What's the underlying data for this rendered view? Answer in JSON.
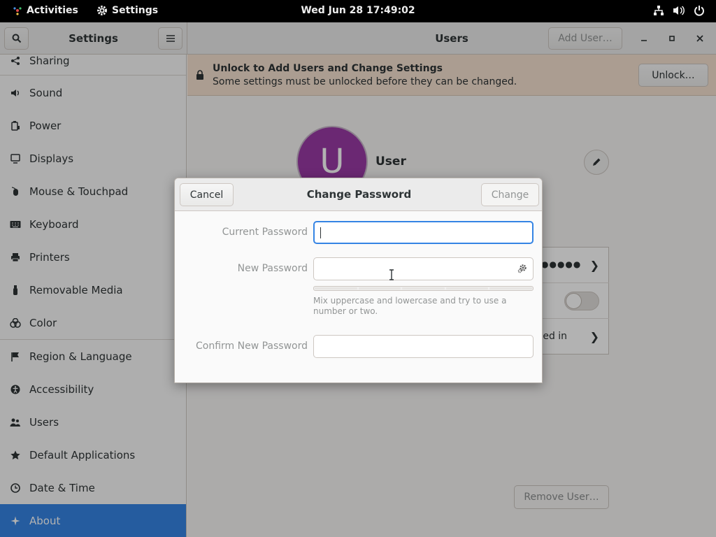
{
  "topbar": {
    "activities": "Activities",
    "app_menu": "Settings",
    "clock": "Wed Jun 28  17:49:02",
    "status_icons": [
      "network-icon",
      "volume-icon",
      "power-icon"
    ]
  },
  "headerbar": {
    "left_title": "Settings",
    "main_title": "Users",
    "add_user_label": "Add User…"
  },
  "sidebar": {
    "items": [
      {
        "label": "Sharing",
        "icon": "share-icon"
      },
      {
        "label": "Sound",
        "icon": "speaker-icon"
      },
      {
        "label": "Power",
        "icon": "battery-icon"
      },
      {
        "label": "Displays",
        "icon": "display-icon"
      },
      {
        "label": "Mouse & Touchpad",
        "icon": "mouse-icon"
      },
      {
        "label": "Keyboard",
        "icon": "keyboard-icon"
      },
      {
        "label": "Printers",
        "icon": "printer-icon"
      },
      {
        "label": "Removable Media",
        "icon": "usb-icon"
      },
      {
        "label": "Color",
        "icon": "palette-icon"
      },
      {
        "label": "Region & Language",
        "icon": "flag-icon"
      },
      {
        "label": "Accessibility",
        "icon": "accessibility-icon"
      },
      {
        "label": "Users",
        "icon": "users-icon"
      },
      {
        "label": "Default Applications",
        "icon": "star-icon"
      },
      {
        "label": "Date & Time",
        "icon": "clock-icon"
      },
      {
        "label": "About",
        "icon": "sparkle-icon",
        "active": true
      }
    ]
  },
  "infobar": {
    "title": "Unlock to Add Users and Change Settings",
    "subtitle": "Some settings must be unlocked before they can be changed.",
    "unlock_label": "Unlock…"
  },
  "user": {
    "initial": "U",
    "name": "User",
    "password_mask": "●●●●●",
    "autologin_text": "ogged in",
    "remove_label": "Remove User…"
  },
  "dialog": {
    "title": "Change Password",
    "cancel_label": "Cancel",
    "change_label": "Change",
    "current_password_label": "Current Password",
    "new_password_label": "New Password",
    "confirm_password_label": "Confirm New Password",
    "hint": "Mix uppercase and lowercase and try to use a number or two.",
    "strength_level": 0
  },
  "colors": {
    "accent": "#3584e4",
    "avatar": "#9a3aa5",
    "infobar": "#f5e1d0"
  }
}
